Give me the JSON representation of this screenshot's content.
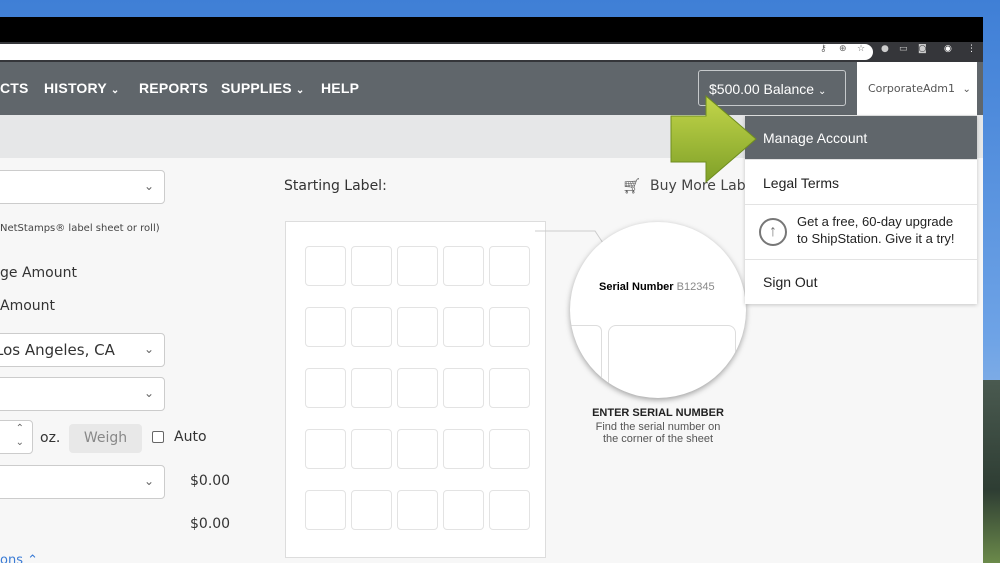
{
  "nav": {
    "items": [
      {
        "label": "CTS",
        "chevron": false
      },
      {
        "label": "HISTORY",
        "chevron": true
      },
      {
        "label": "REPORTS",
        "chevron": false
      },
      {
        "label": "SUPPLIES",
        "chevron": true
      },
      {
        "label": "HELP",
        "chevron": false
      }
    ],
    "balance": "$500.00 Balance",
    "user": "CorporateAdm1"
  },
  "form": {
    "sheet_note": "NetStamps® label sheet or roll)",
    "option1": "ge Amount",
    "option2": "Amount",
    "from_value": "Los Angeles, CA",
    "weight_unit": "oz.",
    "weigh_button": "Weigh",
    "auto_label": "Auto",
    "price1": "$0.00",
    "price2": "$0.00",
    "more_link": "ons"
  },
  "label": {
    "starting_label": "Starting Label:",
    "buy_more": "Buy More Lab",
    "serial_label": "Serial Number",
    "serial_value": "B12345",
    "enter_title": "ENTER SERIAL NUMBER",
    "enter_desc1": "Find the serial number on",
    "enter_desc2": "the corner of the sheet"
  },
  "menu": {
    "items": [
      "Manage Account",
      "Legal Terms",
      "Get a free, 60-day upgrade",
      "to ShipStation. Give it a try!",
      "Sign Out"
    ]
  },
  "colors": {
    "nav": "#60666b",
    "highlight": "#60666b",
    "arrow": "#9cbc2c"
  }
}
